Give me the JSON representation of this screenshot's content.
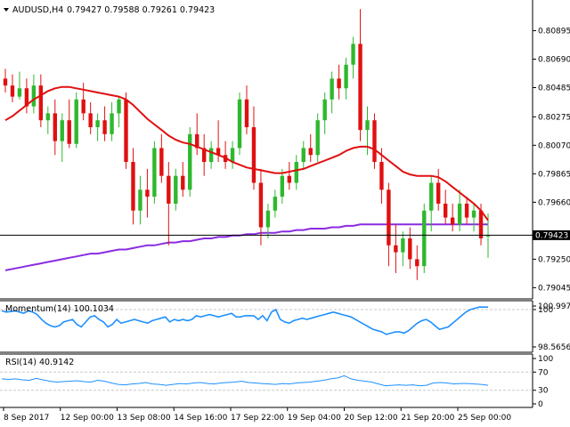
{
  "header": {
    "symbol_label": "AUDUSD,H4",
    "ohlc_values": "0.79427 0.79588 0.79261 0.79423",
    "momentum_label": "Momentum(14) 100.1034",
    "rsi_label": "RSI(14) 40.9142"
  },
  "colors": {
    "bull": "#2eb82e",
    "bear": "#e01010",
    "ma_fast": "#e01010",
    "ma_slow": "#8a2be2",
    "indicator": "#1e90ff",
    "grid": "#c8c8c8",
    "price_tag_bg": "#000000"
  },
  "chart_data": [
    {
      "type": "candlestick",
      "title": "AUDUSD,H4",
      "ylim": [
        0.7899,
        0.8109
      ],
      "yticks": [
        "0.80895",
        "0.80690",
        "0.80485",
        "0.80275",
        "0.80070",
        "0.79865",
        "0.79660",
        "0.79250",
        "0.79045"
      ],
      "current_price": "0.79423",
      "x_tick_labels": [
        "8 Sep 2017",
        "12 Sep 00:00",
        "13 Sep 08:00",
        "14 Sep 16:00",
        "17 Sep 22:00",
        "19 Sep 04:00",
        "20 Sep 12:00",
        "21 Sep 20:00",
        "25 Sep 00:00"
      ],
      "candles": [
        [
          0.8055,
          0.8062,
          0.8045,
          0.805
        ],
        [
          0.805,
          0.8058,
          0.8038,
          0.8042
        ],
        [
          0.8042,
          0.806,
          0.804,
          0.8048
        ],
        [
          0.8048,
          0.8055,
          0.803,
          0.8035
        ],
        [
          0.8035,
          0.8058,
          0.803,
          0.805
        ],
        [
          0.805,
          0.8058,
          0.802,
          0.8025
        ],
        [
          0.8025,
          0.8035,
          0.8015,
          0.803
        ],
        [
          0.803,
          0.804,
          0.8,
          0.801
        ],
        [
          0.801,
          0.803,
          0.7995,
          0.8025
        ],
        [
          0.8025,
          0.804,
          0.8005,
          0.8008
        ],
        [
          0.8008,
          0.8045,
          0.8005,
          0.804
        ],
        [
          0.804,
          0.8052,
          0.8025,
          0.803
        ],
        [
          0.803,
          0.8038,
          0.8015,
          0.802
        ],
        [
          0.802,
          0.803,
          0.801,
          0.8025
        ],
        [
          0.8025,
          0.8035,
          0.801,
          0.8015
        ],
        [
          0.8015,
          0.8038,
          0.801,
          0.803
        ],
        [
          0.803,
          0.8042,
          0.802,
          0.804
        ],
        [
          0.804,
          0.8045,
          0.799,
          0.7995
        ],
        [
          0.7995,
          0.8005,
          0.795,
          0.796
        ],
        [
          0.796,
          0.7985,
          0.795,
          0.7975
        ],
        [
          0.7975,
          0.799,
          0.7955,
          0.797
        ],
        [
          0.797,
          0.801,
          0.7965,
          0.8005
        ],
        [
          0.8005,
          0.8015,
          0.798,
          0.7985
        ],
        [
          0.7985,
          0.7995,
          0.7935,
          0.7965
        ],
        [
          0.7965,
          0.799,
          0.796,
          0.7985
        ],
        [
          0.7985,
          0.7995,
          0.797,
          0.7975
        ],
        [
          0.7975,
          0.802,
          0.797,
          0.8015
        ],
        [
          0.8015,
          0.803,
          0.8,
          0.8005
        ],
        [
          0.8005,
          0.8015,
          0.7985,
          0.7995
        ],
        [
          0.7995,
          0.801,
          0.799,
          0.8005
        ],
        [
          0.8005,
          0.8025,
          0.7995,
          0.8
        ],
        [
          0.8,
          0.801,
          0.799,
          0.7995
        ],
        [
          0.7995,
          0.801,
          0.799,
          0.8005
        ],
        [
          0.8005,
          0.8045,
          0.8,
          0.804
        ],
        [
          0.804,
          0.805,
          0.8015,
          0.802
        ],
        [
          0.802,
          0.8035,
          0.7975,
          0.798
        ],
        [
          0.798,
          0.799,
          0.7935,
          0.7948
        ],
        [
          0.7948,
          0.7965,
          0.794,
          0.796
        ],
        [
          0.796,
          0.7975,
          0.7955,
          0.797
        ],
        [
          0.797,
          0.799,
          0.7965,
          0.7985
        ],
        [
          0.7985,
          0.7995,
          0.7975,
          0.798
        ],
        [
          0.798,
          0.8,
          0.7975,
          0.7995
        ],
        [
          0.7995,
          0.801,
          0.799,
          0.8005
        ],
        [
          0.8005,
          0.8015,
          0.7995,
          0.8
        ],
        [
          0.8,
          0.803,
          0.7995,
          0.8025
        ],
        [
          0.8025,
          0.8045,
          0.8015,
          0.804
        ],
        [
          0.804,
          0.806,
          0.803,
          0.8055
        ],
        [
          0.8055,
          0.8065,
          0.804,
          0.8048
        ],
        [
          0.8048,
          0.807,
          0.804,
          0.8065
        ],
        [
          0.8065,
          0.8085,
          0.8055,
          0.808
        ],
        [
          0.808,
          0.8105,
          0.801,
          0.8018
        ],
        [
          0.8018,
          0.8035,
          0.8,
          0.8025
        ],
        [
          0.8025,
          0.803,
          0.799,
          0.7995
        ],
        [
          0.7995,
          0.8005,
          0.7965,
          0.7975
        ],
        [
          0.7975,
          0.798,
          0.792,
          0.7935
        ],
        [
          0.7935,
          0.795,
          0.7915,
          0.793
        ],
        [
          0.793,
          0.7945,
          0.792,
          0.794
        ],
        [
          0.794,
          0.7948,
          0.7918,
          0.7925
        ],
        [
          0.7925,
          0.7935,
          0.791,
          0.792
        ],
        [
          0.792,
          0.7965,
          0.7915,
          0.796
        ],
        [
          0.796,
          0.7985,
          0.7945,
          0.798
        ],
        [
          0.798,
          0.799,
          0.796,
          0.7965
        ],
        [
          0.7965,
          0.7975,
          0.795,
          0.7955
        ],
        [
          0.7955,
          0.7965,
          0.7945,
          0.795
        ],
        [
          0.795,
          0.7975,
          0.7945,
          0.7965
        ],
        [
          0.7965,
          0.797,
          0.795,
          0.7955
        ],
        [
          0.7955,
          0.7965,
          0.7945,
          0.796
        ],
        [
          0.796,
          0.7965,
          0.7935,
          0.794
        ],
        [
          0.7942,
          0.7958,
          0.7926,
          0.7942
        ]
      ],
      "ma_fast": [
        0.8025,
        0.8028,
        0.8032,
        0.8036,
        0.804,
        0.8043,
        0.8046,
        0.8048,
        0.8049,
        0.8049,
        0.8048,
        0.8047,
        0.8046,
        0.8045,
        0.8044,
        0.8043,
        0.8042,
        0.804,
        0.8036,
        0.8031,
        0.8026,
        0.8022,
        0.8018,
        0.8014,
        0.8011,
        0.8009,
        0.8008,
        0.8006,
        0.8004,
        0.8002,
        0.8,
        0.7998,
        0.7995,
        0.7993,
        0.7991,
        0.799,
        0.7989,
        0.7988,
        0.7987,
        0.7987,
        0.7988,
        0.7989,
        0.799,
        0.7992,
        0.7994,
        0.7996,
        0.7998,
        0.8,
        0.8003,
        0.8005,
        0.8006,
        0.8006,
        0.8004,
        0.8,
        0.7996,
        0.7992,
        0.7988,
        0.7986,
        0.7985,
        0.7985,
        0.7985,
        0.7984,
        0.7981,
        0.7977,
        0.7973,
        0.7969,
        0.7965,
        0.796,
        0.7953
      ],
      "ma_slow": [
        0.7917,
        0.7918,
        0.7919,
        0.792,
        0.7921,
        0.7922,
        0.7923,
        0.7924,
        0.7925,
        0.7926,
        0.7927,
        0.7928,
        0.7929,
        0.7929,
        0.793,
        0.7931,
        0.7932,
        0.7932,
        0.7933,
        0.7934,
        0.7935,
        0.7935,
        0.7936,
        0.7937,
        0.7937,
        0.7938,
        0.7938,
        0.7939,
        0.794,
        0.794,
        0.7941,
        0.7941,
        0.7942,
        0.7942,
        0.7943,
        0.7943,
        0.7944,
        0.7944,
        0.7944,
        0.7945,
        0.7945,
        0.7946,
        0.7946,
        0.7947,
        0.7947,
        0.7947,
        0.7948,
        0.7948,
        0.7949,
        0.7949,
        0.795,
        0.795,
        0.795,
        0.795,
        0.795,
        0.795,
        0.795,
        0.795,
        0.795,
        0.795,
        0.795,
        0.795,
        0.795,
        0.795,
        0.795,
        0.795,
        0.795,
        0.795,
        0.795
      ]
    },
    {
      "type": "line",
      "title": "Momentum(14) 100.1034",
      "ylim": [
        98.35,
        100.25
      ],
      "yticks": [
        "100.9973",
        "100",
        "98.5656"
      ],
      "values": [
        99.95,
        99.9,
        99.92,
        99.95,
        99.9,
        99.85,
        99.95,
        99.9,
        99.8,
        99.6,
        99.45,
        99.35,
        99.3,
        99.35,
        99.5,
        99.55,
        99.6,
        99.4,
        99.3,
        99.5,
        99.7,
        99.75,
        99.6,
        99.5,
        99.3,
        99.4,
        99.6,
        99.45,
        99.5,
        99.55,
        99.6,
        99.55,
        99.5,
        99.45,
        99.55,
        99.6,
        99.65,
        99.7,
        99.5,
        99.6,
        99.55,
        99.6,
        99.55,
        99.6,
        99.75,
        99.7,
        99.75,
        99.8,
        99.75,
        99.7,
        99.75,
        99.8,
        99.85,
        99.7,
        99.7,
        99.75,
        99.75,
        99.75,
        99.6,
        99.75,
        99.55,
        99.9,
        100.0,
        99.6,
        99.5,
        99.45,
        99.55,
        99.6,
        99.65,
        99.6,
        99.65,
        99.7,
        99.75,
        99.8,
        99.85,
        99.9,
        99.85,
        99.8,
        99.75,
        99.7,
        99.6,
        99.5,
        99.4,
        99.3,
        99.2,
        99.15,
        99.1,
        99.0,
        99.05,
        99.1,
        99.1,
        99.05,
        99.15,
        99.3,
        99.45,
        99.55,
        99.6,
        99.5,
        99.35,
        99.2,
        99.25,
        99.3,
        99.45,
        99.6,
        99.75,
        99.9,
        100.0,
        100.05,
        100.1,
        100.1,
        100.1
      ]
    },
    {
      "type": "line",
      "title": "RSI(14) 40.9142",
      "ylim": [
        0,
        100
      ],
      "yticks": [
        "100",
        "70",
        "30",
        "0"
      ],
      "values": [
        55,
        54,
        55,
        53,
        52,
        56,
        53,
        50,
        48,
        49,
        50,
        51,
        49,
        48,
        52,
        50,
        46,
        43,
        42,
        44,
        45,
        47,
        44,
        43,
        41,
        43,
        45,
        44,
        46,
        47,
        45,
        44,
        46,
        47,
        48,
        50,
        47,
        46,
        45,
        44,
        43,
        45,
        44,
        46,
        47,
        48,
        50,
        52,
        55,
        57,
        62,
        55,
        52,
        50,
        48,
        44,
        40,
        41,
        42,
        41,
        42,
        40,
        41,
        46,
        47,
        46,
        44,
        45,
        45,
        44,
        43,
        41
      ]
    }
  ]
}
